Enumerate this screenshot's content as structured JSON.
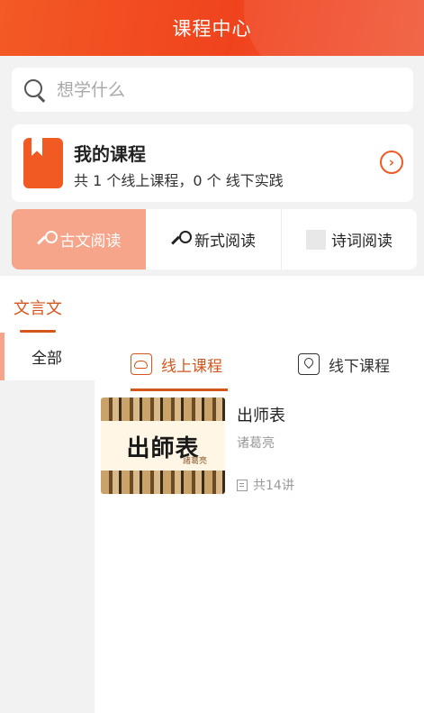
{
  "header": {
    "title": "课程中心"
  },
  "search": {
    "placeholder": "想学什么",
    "icon": "search-icon"
  },
  "my_course": {
    "title": "我的课程",
    "summary": "共 1 个线上课程，0 个 线下实践",
    "icon": "bookmark-icon",
    "arrow_icon": "chevron-right-circle-icon"
  },
  "categories": [
    {
      "label": "古文阅读",
      "icon": "wrench-icon",
      "active": true
    },
    {
      "label": "新式阅读",
      "icon": "wrench-icon",
      "active": false
    },
    {
      "label": "诗词阅读",
      "icon": "placeholder-square",
      "active": false
    }
  ],
  "section": {
    "label": "文言文"
  },
  "sidebar": {
    "items": [
      {
        "label": "全部",
        "active": true
      }
    ]
  },
  "subtabs": [
    {
      "label": "线上课程",
      "icon": "cloud-icon",
      "active": true
    },
    {
      "label": "线下课程",
      "icon": "location-icon",
      "active": false
    }
  ],
  "courses": [
    {
      "title": "出师表",
      "author": "诸葛亮",
      "lessons": "共14讲",
      "cover_title": "出師表",
      "cover_author": "諸葛亮"
    }
  ],
  "colors": {
    "accent": "#f15a22",
    "accent_text": "#d4561c",
    "active_tab_bg": "#f6a58a"
  }
}
